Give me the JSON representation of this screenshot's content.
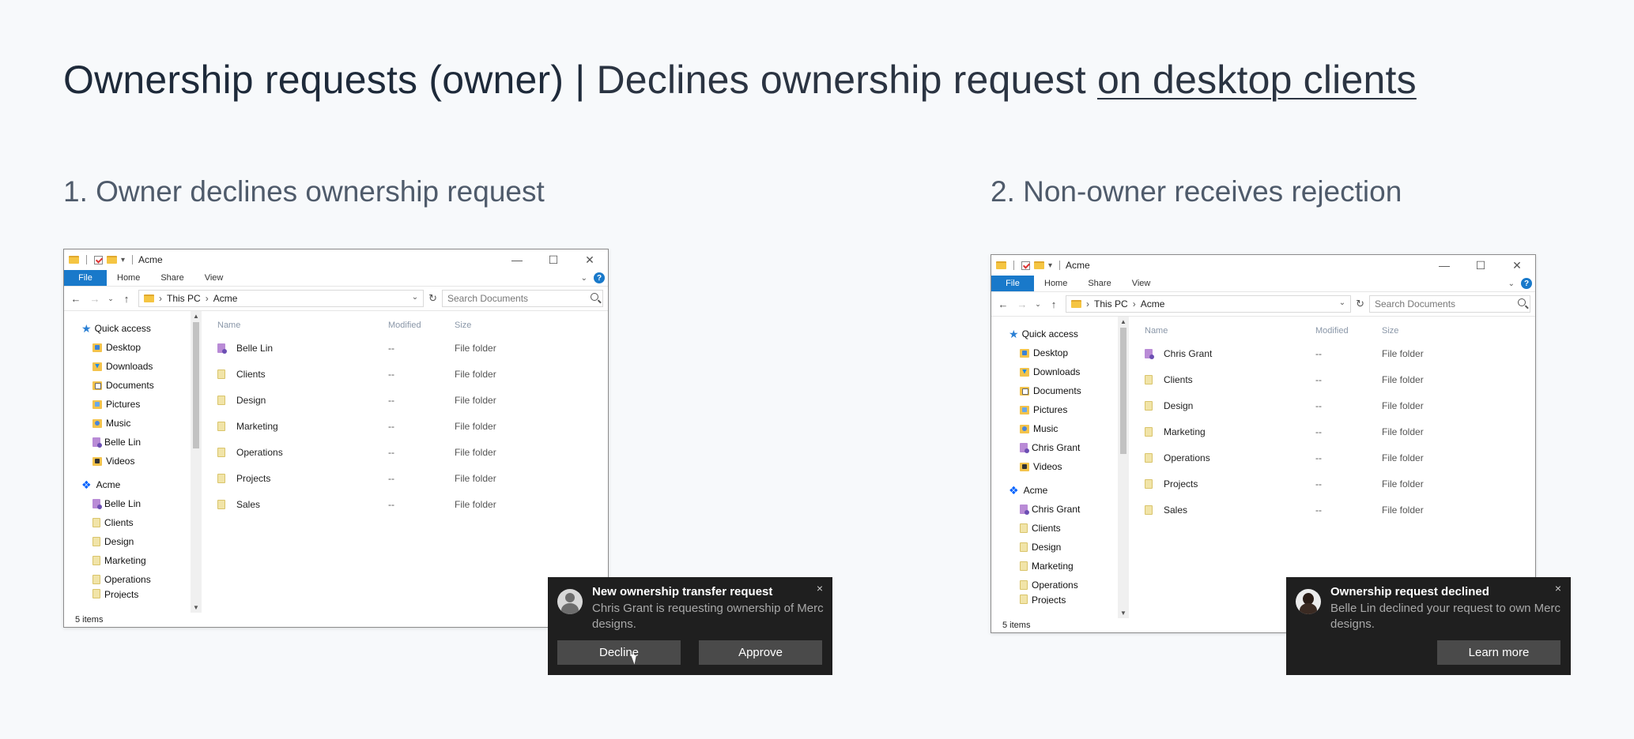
{
  "page_title": {
    "bold": "Ownership requests (owner)",
    "separator": "|",
    "subtitle": "Declines ownership request",
    "link": "on desktop clients"
  },
  "sections": [
    {
      "title": "1. Owner declines ownership request",
      "window": {
        "title": "Acme",
        "ribbon_tabs": [
          "File",
          "Home",
          "Share",
          "View"
        ],
        "breadcrumb": [
          "This PC",
          "Acme"
        ],
        "search_placeholder": "Search Documents",
        "nav_items": [
          {
            "label": "Quick access",
            "icon": "star-icon"
          },
          {
            "label": "Desktop",
            "icon": "desktop-folder-icon",
            "pinned": true
          },
          {
            "label": "Downloads",
            "icon": "downloads-folder-icon",
            "pinned": true
          },
          {
            "label": "Documents",
            "icon": "documents-folder-icon",
            "pinned": true
          },
          {
            "label": "Pictures",
            "icon": "pictures-folder-icon",
            "pinned": true
          },
          {
            "label": "Music",
            "icon": "music-folder-icon"
          },
          {
            "label": "Belle Lin",
            "icon": "user-folder-icon"
          },
          {
            "label": "Videos",
            "icon": "videos-folder-icon"
          },
          {
            "label": "Acme",
            "icon": "dropbox-icon"
          },
          {
            "label": "Belle Lin",
            "icon": "user-folder-icon"
          },
          {
            "label": "Clients",
            "icon": "folder-icon"
          },
          {
            "label": "Design",
            "icon": "folder-icon"
          },
          {
            "label": "Marketing",
            "icon": "folder-icon"
          },
          {
            "label": "Operations",
            "icon": "folder-icon"
          },
          {
            "label": "Projects",
            "icon": "folder-icon"
          }
        ],
        "columns": [
          "Name",
          "Modified",
          "Size"
        ],
        "files": [
          {
            "name": "Belle Lin",
            "modified": "--",
            "size": "File folder",
            "icon": "user-folder-icon"
          },
          {
            "name": "Clients",
            "modified": "--",
            "size": "File folder",
            "icon": "folder-icon"
          },
          {
            "name": "Design",
            "modified": "--",
            "size": "File folder",
            "icon": "folder-icon"
          },
          {
            "name": "Marketing",
            "modified": "--",
            "size": "File folder",
            "icon": "folder-icon"
          },
          {
            "name": "Operations",
            "modified": "--",
            "size": "File folder",
            "icon": "folder-icon"
          },
          {
            "name": "Projects",
            "modified": "--",
            "size": "File folder",
            "icon": "folder-icon"
          },
          {
            "name": "Sales",
            "modified": "--",
            "size": "File folder",
            "icon": "folder-icon"
          }
        ],
        "status": "5 items"
      },
      "toast": {
        "title": "New ownership transfer request",
        "body": "Chris Grant is requesting ownership of Merc designs.",
        "close": "×",
        "buttons": [
          "Decline",
          "Approve"
        ]
      }
    },
    {
      "title": "2. Non-owner receives rejection",
      "window": {
        "title": "Acme",
        "ribbon_tabs": [
          "File",
          "Home",
          "Share",
          "View"
        ],
        "breadcrumb": [
          "This PC",
          "Acme"
        ],
        "search_placeholder": "Search Documents",
        "nav_items": [
          {
            "label": "Quick access",
            "icon": "star-icon"
          },
          {
            "label": "Desktop",
            "icon": "desktop-folder-icon",
            "pinned": true
          },
          {
            "label": "Downloads",
            "icon": "downloads-folder-icon",
            "pinned": true
          },
          {
            "label": "Documents",
            "icon": "documents-folder-icon",
            "pinned": true
          },
          {
            "label": "Pictures",
            "icon": "pictures-folder-icon",
            "pinned": true
          },
          {
            "label": "Music",
            "icon": "music-folder-icon"
          },
          {
            "label": "Chris Grant",
            "icon": "user-folder-icon"
          },
          {
            "label": "Videos",
            "icon": "videos-folder-icon"
          },
          {
            "label": "Acme",
            "icon": "dropbox-icon"
          },
          {
            "label": "Chris Grant",
            "icon": "user-folder-icon"
          },
          {
            "label": "Clients",
            "icon": "folder-icon"
          },
          {
            "label": "Design",
            "icon": "folder-icon"
          },
          {
            "label": "Marketing",
            "icon": "folder-icon"
          },
          {
            "label": "Operations",
            "icon": "folder-icon"
          },
          {
            "label": "Projects",
            "icon": "folder-icon"
          }
        ],
        "columns": [
          "Name",
          "Modified",
          "Size"
        ],
        "files": [
          {
            "name": "Chris Grant",
            "modified": "--",
            "size": "File folder",
            "icon": "user-folder-icon"
          },
          {
            "name": "Clients",
            "modified": "--",
            "size": "File folder",
            "icon": "folder-icon"
          },
          {
            "name": "Design",
            "modified": "--",
            "size": "File folder",
            "icon": "folder-icon"
          },
          {
            "name": "Marketing",
            "modified": "--",
            "size": "File folder",
            "icon": "folder-icon"
          },
          {
            "name": "Operations",
            "modified": "--",
            "size": "File folder",
            "icon": "folder-icon"
          },
          {
            "name": "Projects",
            "modified": "--",
            "size": "File folder",
            "icon": "folder-icon"
          },
          {
            "name": "Sales",
            "modified": "--",
            "size": "File folder",
            "icon": "folder-icon"
          }
        ],
        "status": "5 items"
      },
      "toast": {
        "title": "Ownership request declined",
        "body": "Belle Lin declined your request to own Merc designs.",
        "close": "×",
        "buttons": [
          "Learn more"
        ]
      }
    }
  ],
  "colors": {
    "accent": "#1979ca",
    "toast_bg": "#1f1f1f",
    "toast_button": "#4a4a4a",
    "heading": "#1e2a3a",
    "section_heading": "#4f5b6b"
  }
}
